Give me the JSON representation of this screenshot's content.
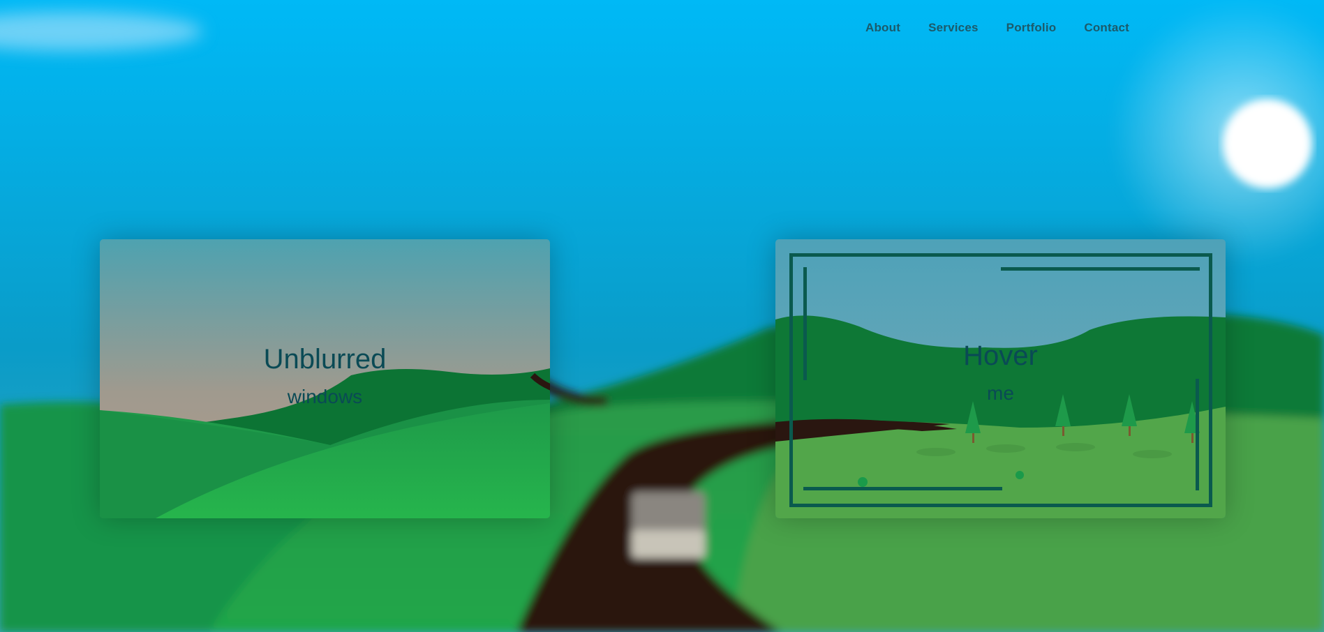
{
  "nav": {
    "items": [
      "About",
      "Services",
      "Portfolio",
      "Contact"
    ]
  },
  "cards": {
    "left": {
      "title": "Unblurred",
      "subtitle": "windows"
    },
    "right": {
      "title": "Hover",
      "subtitle": "me"
    }
  },
  "colors": {
    "sky_top": "#00b8f5",
    "sky_bottom": "#0a8fb5",
    "hill_dark": "#0e7436",
    "hill_light": "#22b24a",
    "road": "#2a1610",
    "card_text": "#0a4a55",
    "frame": "#0a5a4e"
  }
}
